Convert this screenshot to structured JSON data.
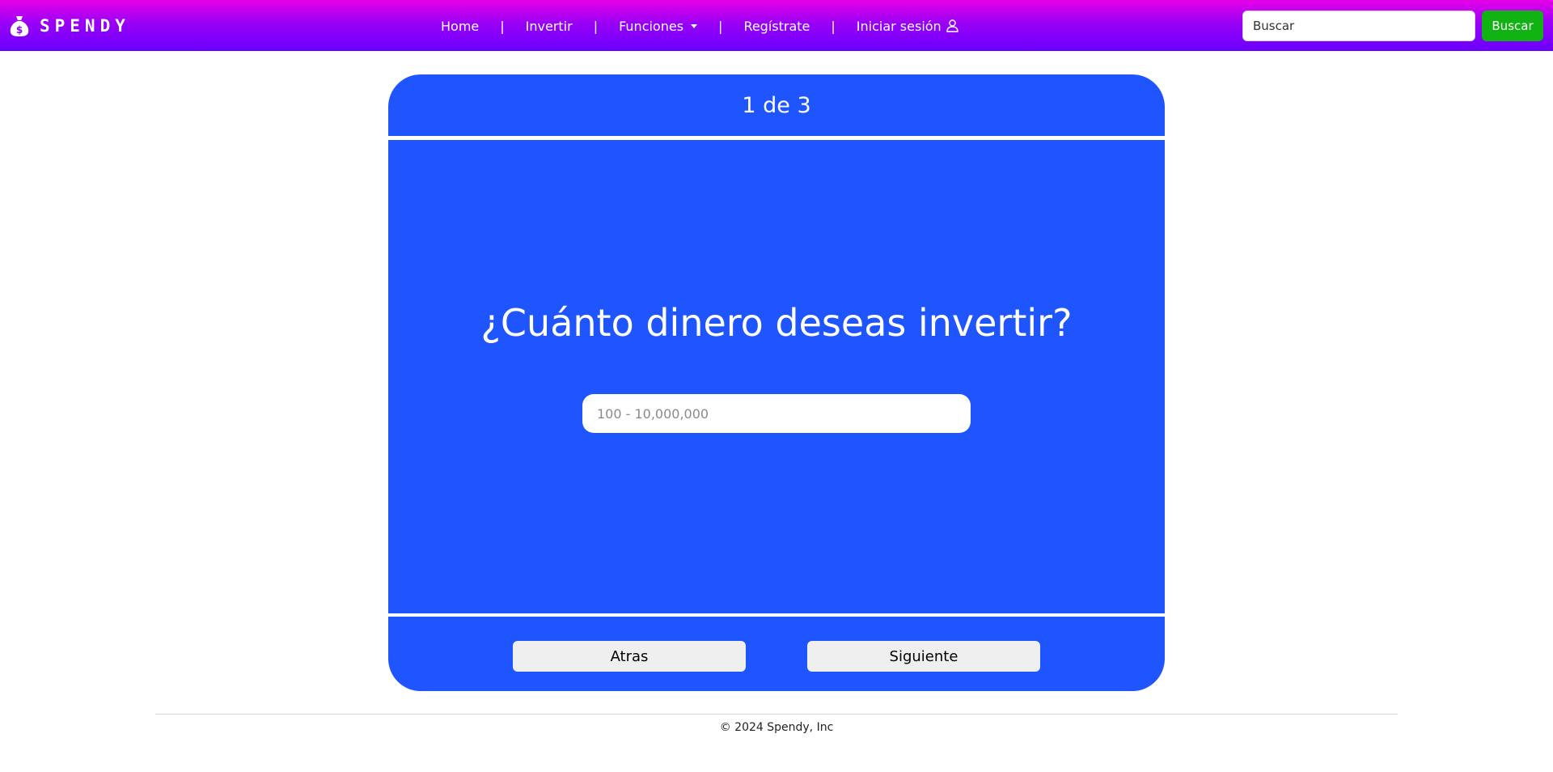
{
  "brand": {
    "name": "SPENDY",
    "icon": "money-bag-icon"
  },
  "nav": {
    "home": "Home",
    "invest": "Invertir",
    "functions": "Funciones",
    "register": "Regístrate",
    "login": "Iniciar sesión",
    "separator": "|"
  },
  "search": {
    "placeholder": "Buscar",
    "button": "Buscar"
  },
  "card": {
    "step": "1 de 3",
    "question": "¿Cuánto dinero deseas invertir?",
    "amount_placeholder": "100 - 10,000,000",
    "back_label": "Atras",
    "next_label": "Siguiente"
  },
  "footer": {
    "copyright": "© 2024 Spendy, Inc"
  },
  "colors": {
    "navbar_top": "#e600e8",
    "navbar_bottom": "#6a00ff",
    "card_bg": "#1e55ff",
    "search_button": "#11b312"
  }
}
